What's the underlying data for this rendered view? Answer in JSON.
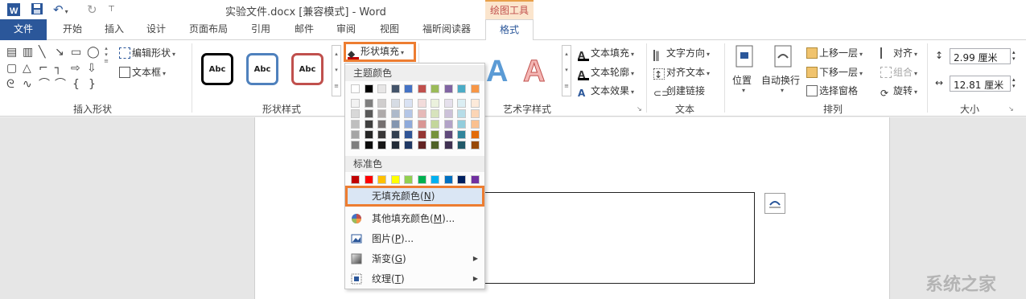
{
  "window": {
    "title": "实验文件.docx [兼容模式] - Word"
  },
  "contextual_tab_group": "绘图工具",
  "tabs": [
    "文件",
    "开始",
    "插入",
    "设计",
    "页面布局",
    "引用",
    "邮件",
    "审阅",
    "视图",
    "福昕阅读器",
    "格式"
  ],
  "active_tab": "格式",
  "ribbon": {
    "insert_shapes": {
      "label": "插入形状",
      "edit_shape": "编辑形状",
      "text_box": "文本框"
    },
    "shape_styles": {
      "label": "形状样式",
      "samples": [
        "Abc",
        "Abc",
        "Abc"
      ],
      "sample_colors": [
        "#000000",
        "#4f81bd",
        "#c0504d"
      ]
    },
    "shape_fill_button": "形状填充",
    "wordart_styles": {
      "label": "艺术字样式",
      "text_fill": "文本填充",
      "text_outline": "文本轮廓",
      "text_effects": "文本效果"
    },
    "text": {
      "label": "文本",
      "text_direction": "文字方向",
      "align_text": "对齐文本",
      "create_link": "创建链接"
    },
    "arrange": {
      "label": "排列",
      "position": "位置",
      "wrap_text": "自动换行",
      "bring_forward": "上移一层",
      "send_backward": "下移一层",
      "selection_pane": "选择窗格",
      "align": "对齐",
      "group": "组合",
      "rotate": "旋转"
    },
    "size": {
      "label": "大小",
      "height": "2.99 厘米",
      "width": "12.81 厘米"
    }
  },
  "fill_menu": {
    "theme_colors_header": "主题颜色",
    "standard_colors_header": "标准色",
    "theme_top_row": [
      "#ffffff",
      "#000000",
      "#e7e6e6",
      "#44546a",
      "#4472c4",
      "#c0504d",
      "#9bbb59",
      "#8064a2",
      "#4bacc6",
      "#f79646"
    ],
    "theme_shades": [
      [
        "#f2f2f2",
        "#7f7f7f",
        "#d0cece",
        "#d6dce4",
        "#d9e2f3",
        "#f2dcdb",
        "#ebf1dd",
        "#e5e0ec",
        "#dbeef3",
        "#fdeada"
      ],
      [
        "#d8d8d8",
        "#595959",
        "#aeaaaa",
        "#adb9ca",
        "#b4c6e7",
        "#e6b9b8",
        "#d7e3bc",
        "#ccc1d9",
        "#b7dde8",
        "#fbd5b5"
      ],
      [
        "#bfbfbf",
        "#3f3f3f",
        "#757070",
        "#8496b0",
        "#8eaadb",
        "#d99694",
        "#c3d69b",
        "#b2a2c7",
        "#92cddc",
        "#fac08f"
      ],
      [
        "#a5a5a5",
        "#262626",
        "#3a3838",
        "#323f4f",
        "#2f5496",
        "#953734",
        "#76923c",
        "#5f497a",
        "#31859b",
        "#e36c09"
      ],
      [
        "#7f7f7f",
        "#0c0c0c",
        "#171616",
        "#222a35",
        "#1f3864",
        "#632423",
        "#4f6128",
        "#3f3151",
        "#205867",
        "#974806"
      ]
    ],
    "standard_colors": [
      "#c00000",
      "#ff0000",
      "#ffc000",
      "#ffff00",
      "#92d050",
      "#00b050",
      "#00b0f0",
      "#0070c0",
      "#002060",
      "#7030a0"
    ],
    "items": [
      {
        "label": "无填充颜色",
        "accel": "N"
      },
      {
        "label": "其他填充颜色",
        "accel": "M",
        "suffix": "..."
      },
      {
        "label": "图片",
        "accel": "P",
        "suffix": "..."
      },
      {
        "label": "渐变",
        "accel": "G"
      },
      {
        "label": "纹理",
        "accel": "T"
      }
    ]
  },
  "watermark": "系统之家"
}
